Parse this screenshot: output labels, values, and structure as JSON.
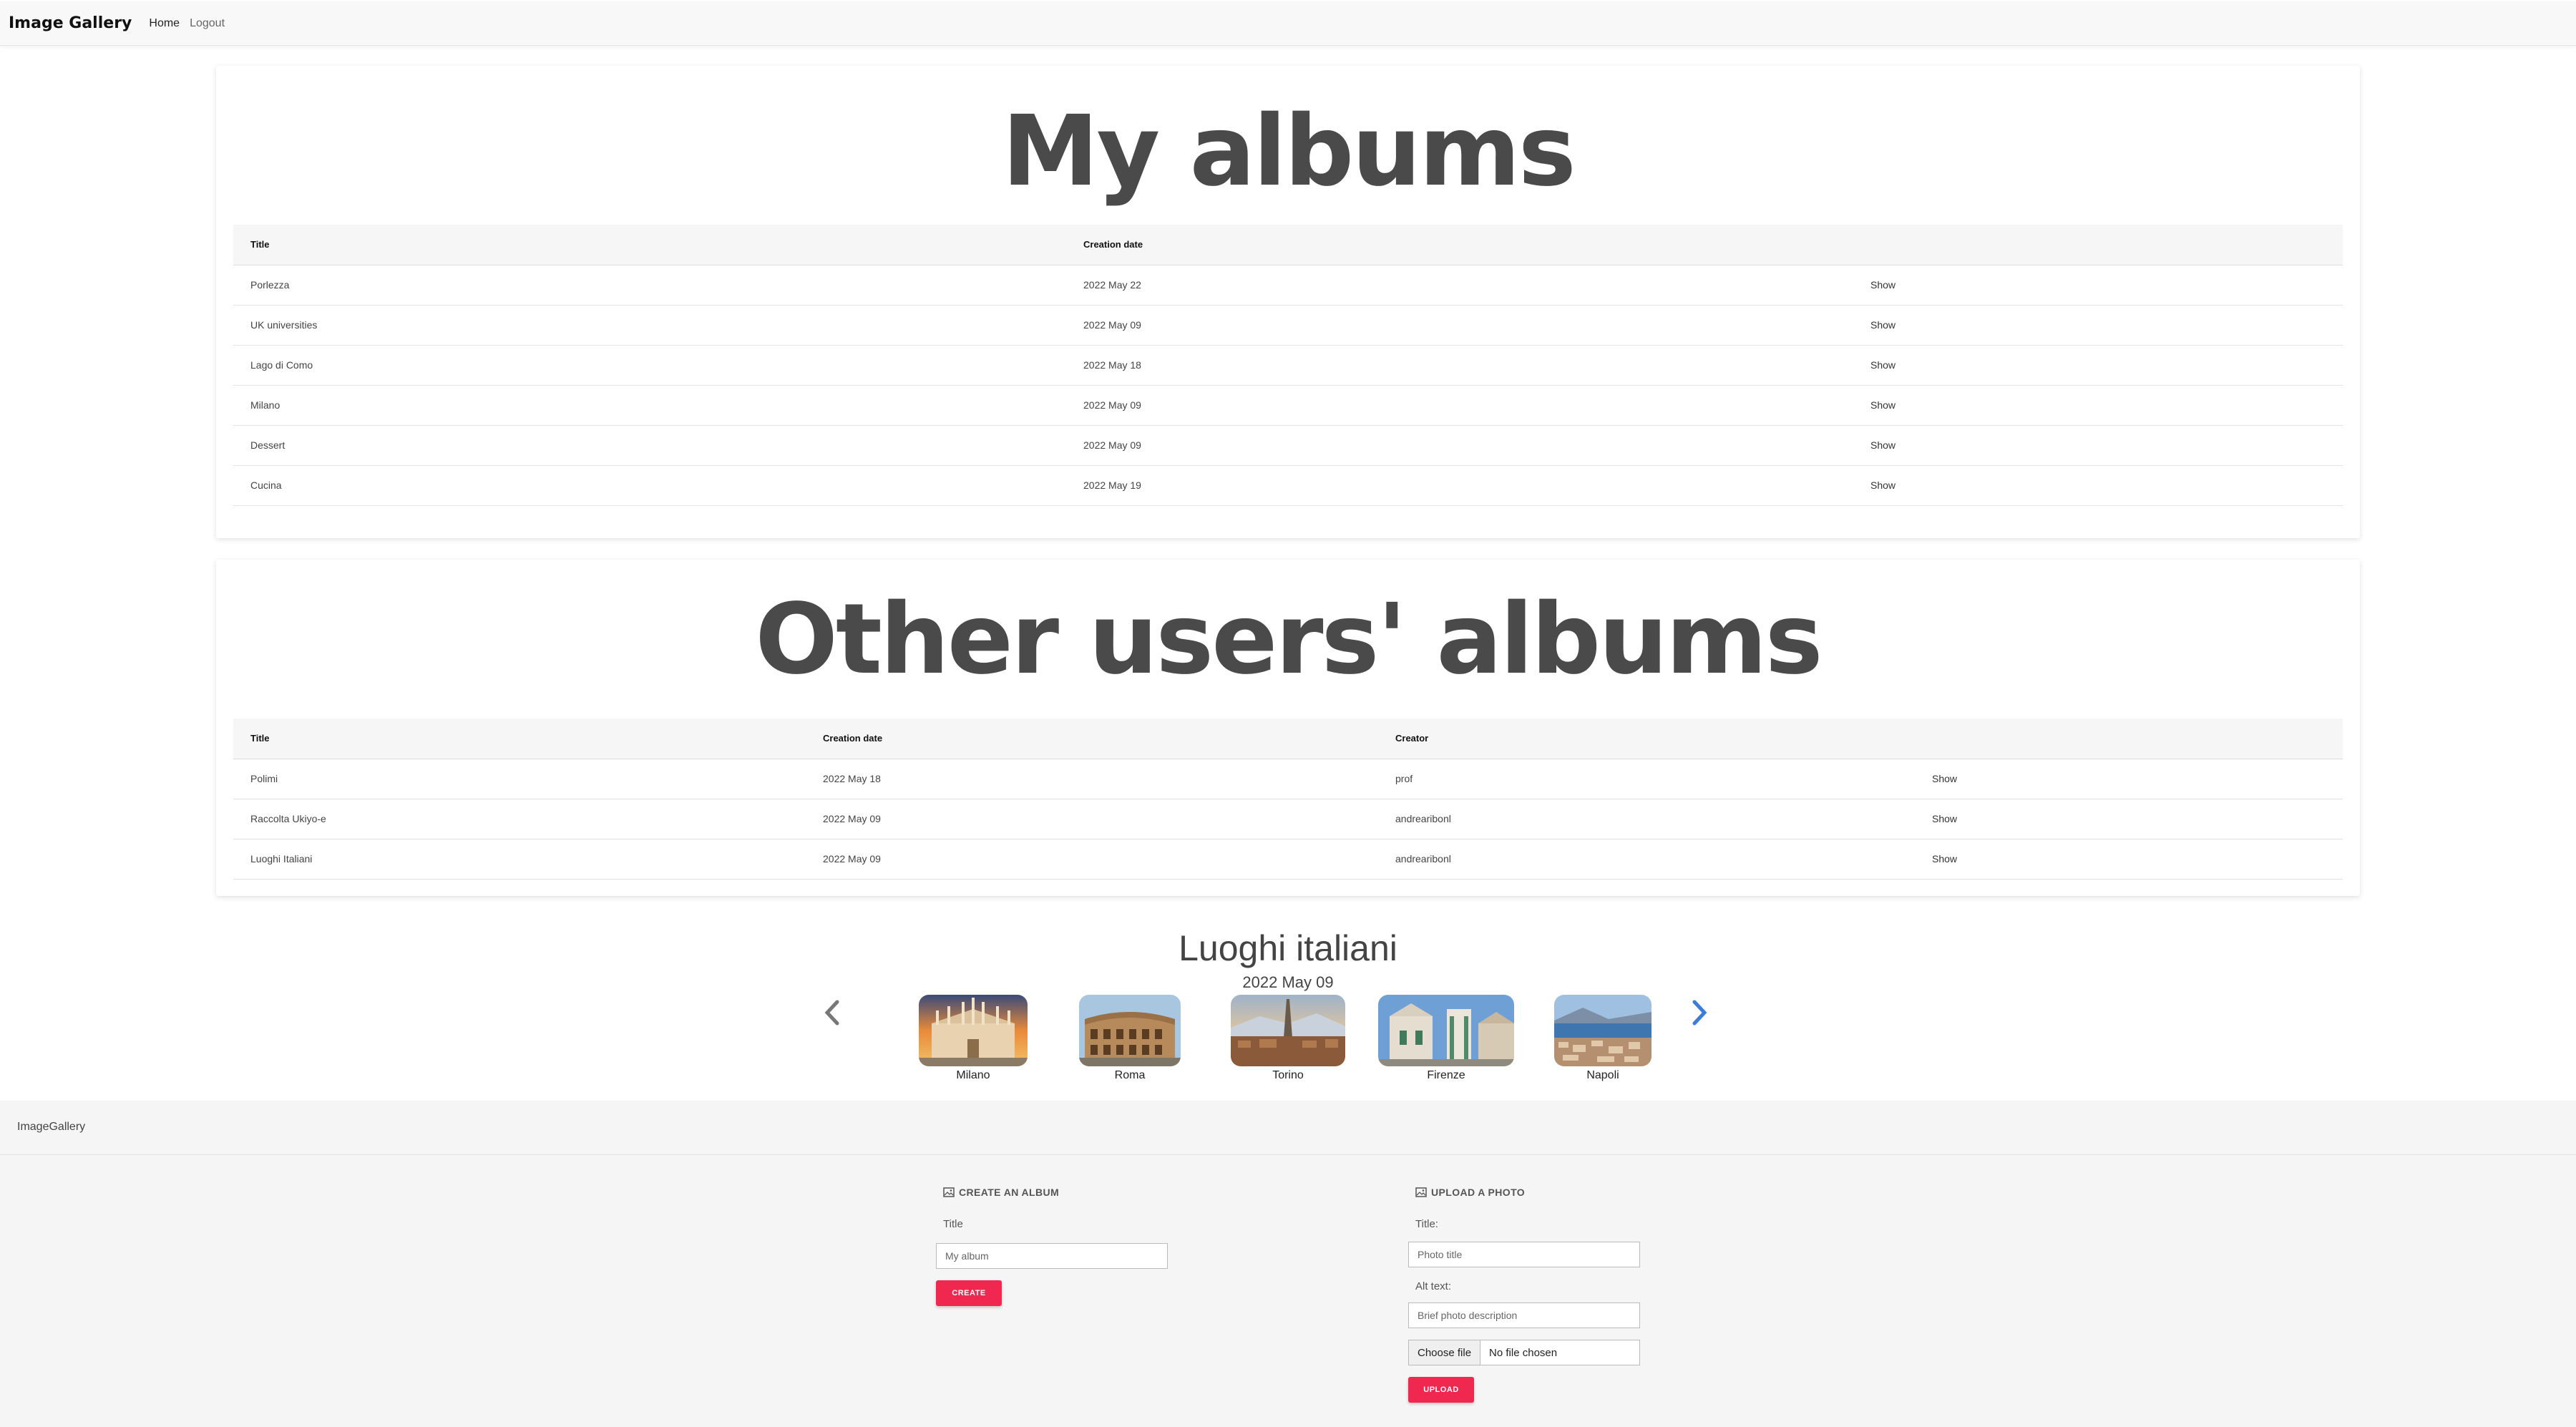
{
  "navbar": {
    "brand": "Image Gallery",
    "links": [
      "Home",
      "Logout"
    ]
  },
  "my_albums": {
    "title": "My albums",
    "columns": [
      "Title",
      "Creation date",
      ""
    ],
    "rows": [
      {
        "title": "Porlezza",
        "date": "2022 May 22",
        "action": "Show"
      },
      {
        "title": "UK universities",
        "date": "2022 May 09",
        "action": "Show"
      },
      {
        "title": "Lago di Como",
        "date": "2022 May 18",
        "action": "Show"
      },
      {
        "title": "Milano",
        "date": "2022 May 09",
        "action": "Show"
      },
      {
        "title": "Dessert",
        "date": "2022 May 09",
        "action": "Show"
      },
      {
        "title": "Cucina",
        "date": "2022 May 19",
        "action": "Show"
      }
    ]
  },
  "other_albums": {
    "title": "Other users' albums",
    "columns": [
      "Title",
      "Creation date",
      "Creator",
      ""
    ],
    "rows": [
      {
        "title": "Polimi",
        "date": "2022 May 18",
        "creator": "prof",
        "action": "Show"
      },
      {
        "title": "Raccolta Ukiyo-e",
        "date": "2022 May 09",
        "creator": "andrearibonl",
        "action": "Show"
      },
      {
        "title": "Luoghi Italiani",
        "date": "2022 May 09",
        "creator": "andrearibonl",
        "action": "Show"
      }
    ]
  },
  "carousel": {
    "title": "Luoghi italiani",
    "date": "2022 May 09",
    "images": [
      {
        "label": "Milano"
      },
      {
        "label": "Roma"
      },
      {
        "label": "Torino"
      },
      {
        "label": "Firenze"
      },
      {
        "label": "Napoli"
      }
    ]
  },
  "footer": {
    "brand": "ImageGallery",
    "create_album": {
      "heading": "CREATE AN ALBUM",
      "title_label": "Title",
      "title_placeholder": "My album",
      "button": "CREATE"
    },
    "upload_photo": {
      "heading": "UPLOAD A PHOTO",
      "title_label": "Title:",
      "title_placeholder": "Photo title",
      "alt_label": "Alt text:",
      "alt_placeholder": "Brief photo description",
      "file_button": "Choose file",
      "file_status": "No file chosen",
      "button": "UPLOAD"
    }
  },
  "colors": {
    "accent": "#f0274f",
    "next_arrow": "#3b7dd8",
    "prev_arrow": "#777777"
  }
}
